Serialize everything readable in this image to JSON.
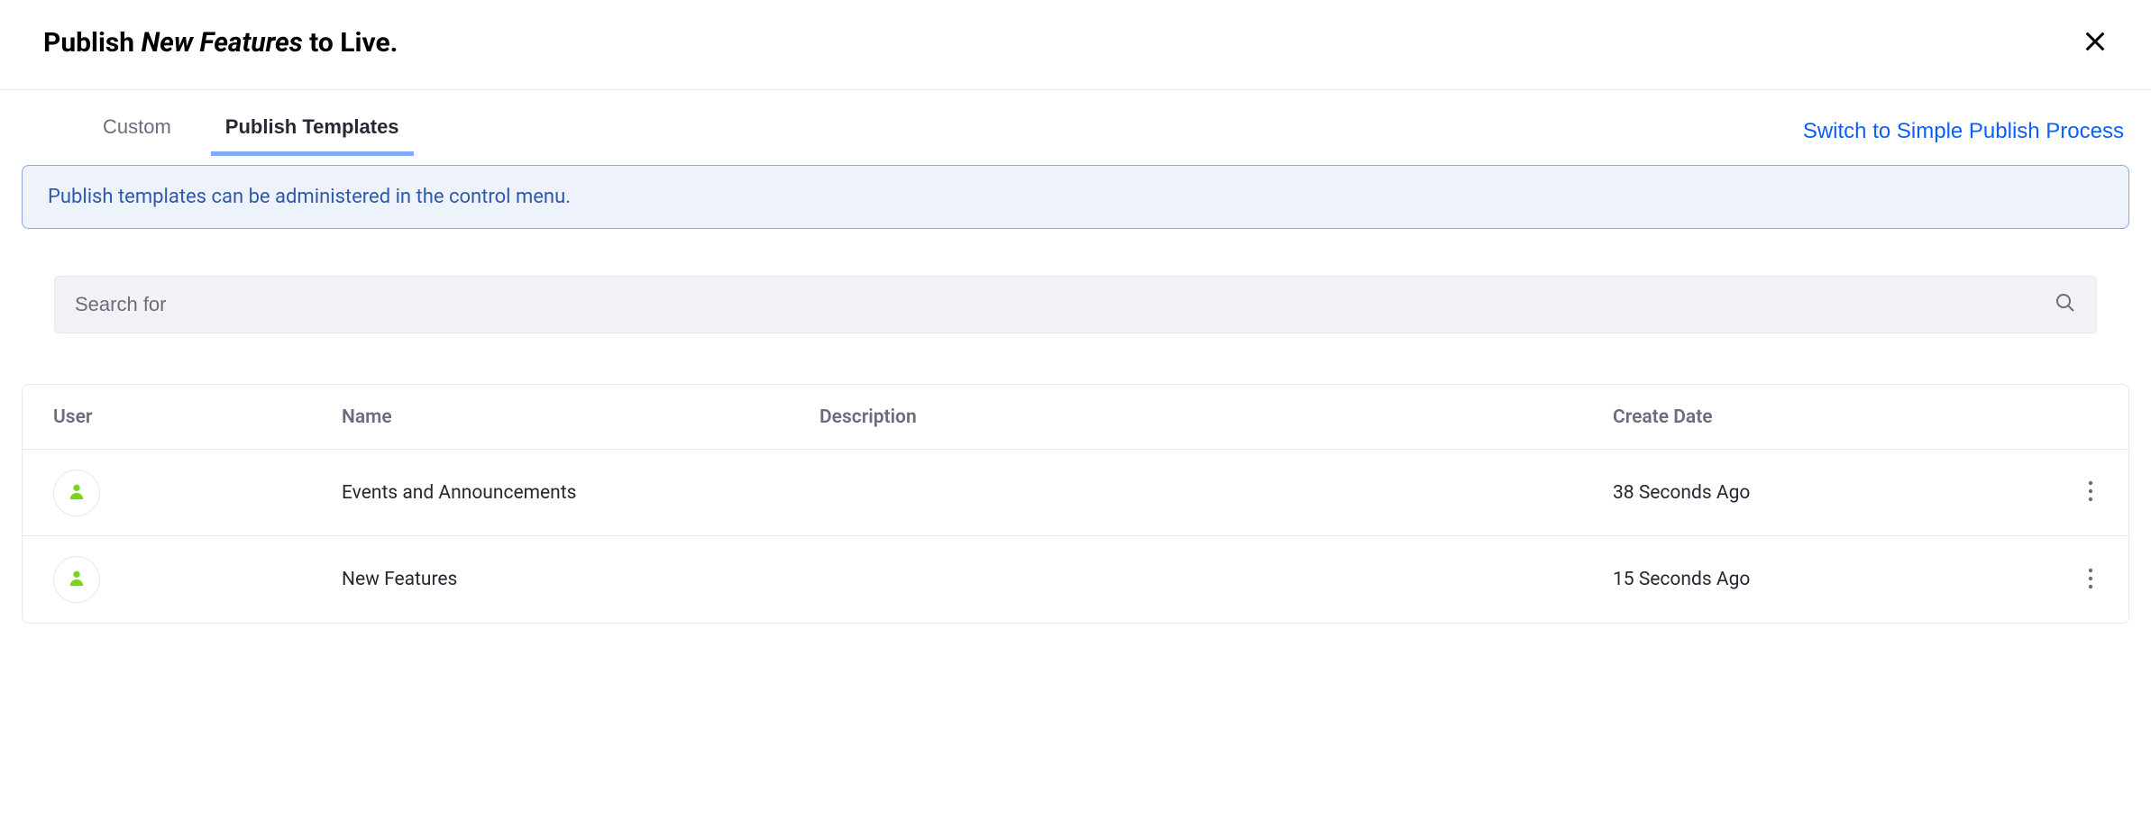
{
  "header": {
    "title_prefix": "Publish ",
    "title_italic": "New Features",
    "title_suffix": " to Live."
  },
  "tabs": {
    "custom": "Custom",
    "publish_templates": "Publish Templates"
  },
  "switch_link": "Switch to Simple Publish Process",
  "info_banner": "Publish templates can be administered in the control menu.",
  "search": {
    "placeholder": "Search for"
  },
  "table": {
    "headers": {
      "user": "User",
      "name": "Name",
      "description": "Description",
      "create_date": "Create Date"
    },
    "rows": [
      {
        "name": "Events and Announcements",
        "description": "",
        "create_date": "38 Seconds Ago"
      },
      {
        "name": "New Features",
        "description": "",
        "create_date": "15 Seconds Ago"
      }
    ]
  }
}
